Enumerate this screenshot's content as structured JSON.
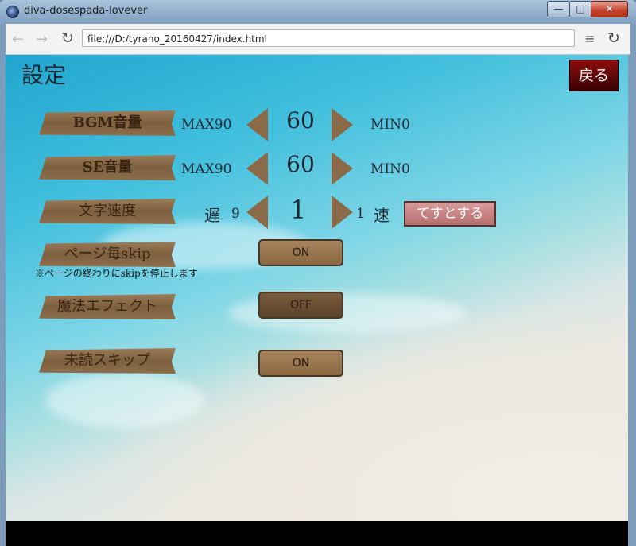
{
  "window": {
    "title": "diva-dosespada-lovever",
    "minimize": "—",
    "maximize": "□",
    "close": "✕"
  },
  "browser": {
    "back": "←",
    "forward": "→",
    "reload": "↻",
    "url": "file:///D:/tyrano_20160427/index.html",
    "menu": "≡"
  },
  "settings": {
    "title": "設定",
    "back_button": "戻る",
    "bgm": {
      "label": "BGM音量",
      "max_label": "MAX90",
      "value": "60",
      "min_label": "MIN0"
    },
    "se": {
      "label": "SE音量",
      "max_label": "MAX90",
      "value": "60",
      "min_label": "MIN0"
    },
    "text_speed": {
      "label": "文字速度",
      "slow_label": "遅",
      "slow_value": "9",
      "value": "1",
      "fast_value": "1",
      "fast_label": "速",
      "test_button": "てすとする"
    },
    "page_skip": {
      "label": "ページ毎skip",
      "state": "ON",
      "note": "※ページの終わりにskipを停止します"
    },
    "magic_effect": {
      "label": "魔法エフェクト",
      "state": "OFF"
    },
    "unread_skip": {
      "label": "未読スキップ",
      "state": "ON"
    }
  },
  "colors": {
    "wood": "#8a6a48",
    "back_button": "#6a0000",
    "test_button": "#c58585"
  }
}
